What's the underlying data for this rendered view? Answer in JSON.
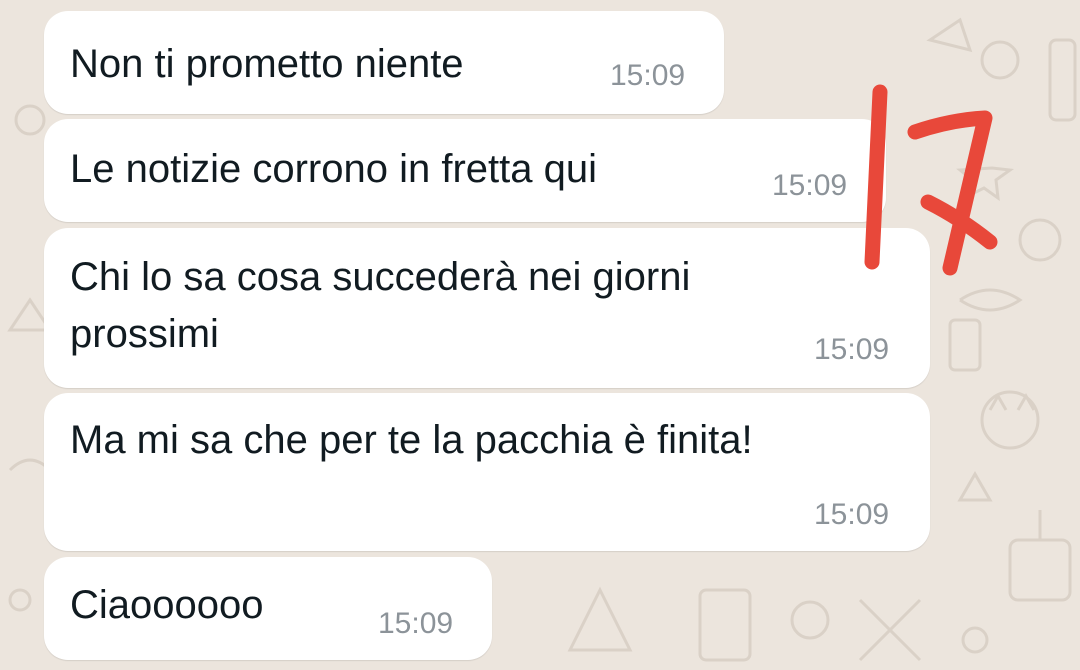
{
  "theme": {
    "background": "#ece5dd",
    "bubble": "#ffffff",
    "text": "#111b21",
    "time": "#8c9399",
    "annotation": "#e8483a"
  },
  "messages": [
    {
      "text": "Non ti prometto niente",
      "time": "15:09"
    },
    {
      "text": "Le notizie corrono in fretta qui",
      "time": "15:09"
    },
    {
      "text": "Chi lo sa cosa succederà nei giorni prossimi",
      "time": "15:09"
    },
    {
      "text": "Ma mi sa che per te la pacchia è finita!",
      "time": "15:09"
    },
    {
      "text": "Ciaoooooo",
      "time": "15:09"
    }
  ],
  "annotation": {
    "text": "17",
    "icon": "handwritten-number-annotation"
  }
}
